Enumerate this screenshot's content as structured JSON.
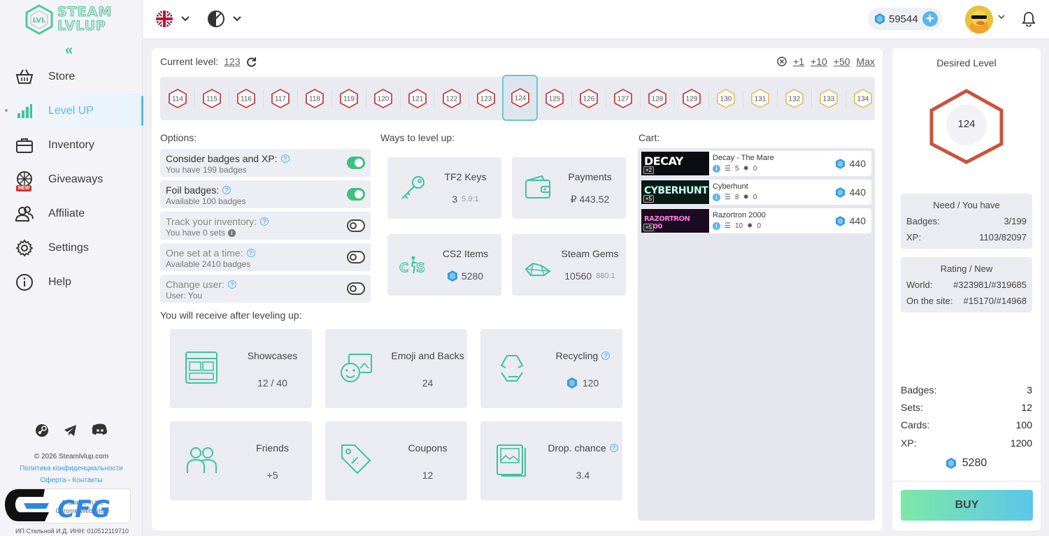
{
  "app": {
    "logo_line1": "STEAM",
    "logo_line2": "LVLUP",
    "accent": "#5db8ec",
    "green": "#3fc07e"
  },
  "sidebar": {
    "items": [
      {
        "label": "Store",
        "icon": "basket-icon"
      },
      {
        "label": "Level UP",
        "icon": "bar-chart-icon",
        "active": true
      },
      {
        "label": "Inventory",
        "icon": "briefcase-icon"
      },
      {
        "label": "Giveaways",
        "icon": "wheel-icon",
        "badge": "NEW"
      },
      {
        "label": "Affiliate",
        "icon": "users-icon"
      },
      {
        "label": "Settings",
        "icon": "gear-icon"
      },
      {
        "label": "Help",
        "icon": "info-icon"
      }
    ],
    "footer": {
      "copyright": "© 2026 Steamlvlup.com",
      "privacy": "Политика конфиденциальности",
      "offer": "Оферта",
      "sep": " - ",
      "contacts": "Контакты",
      "chrome": "Available in the Chrome Web Store",
      "inn": "ИП Стельной И.Д. ИНН: 010512119710"
    }
  },
  "topbar": {
    "balance": "59544"
  },
  "level": {
    "current_label": "Current level:",
    "current": "123",
    "add": [
      "+1",
      "+10",
      "+50",
      "Max"
    ],
    "strip": [
      "114",
      "115",
      "116",
      "117",
      "118",
      "119",
      "120",
      "121",
      "122",
      "123",
      "124",
      "125",
      "126",
      "127",
      "128",
      "129",
      "130",
      "131",
      "132",
      "133",
      "134"
    ],
    "selected": "124"
  },
  "options": {
    "title": "Options:",
    "items": [
      {
        "title": "Consider badges and XP:",
        "sub": "You have 199 badges",
        "on": true
      },
      {
        "title": "Foil badges:",
        "sub": "Available 100 badges",
        "on": true
      },
      {
        "title": "Track your inventory:",
        "sub": "You have 0 sets",
        "on": false
      },
      {
        "title": "One set at a time:",
        "sub": "Available 2410 badges",
        "on": false
      },
      {
        "title": "Change user:",
        "sub": "User: You",
        "on": false
      }
    ]
  },
  "ways": {
    "title": "Ways to level up:",
    "items": [
      {
        "name": "TF2 Keys",
        "value": "3",
        "rate": "5.9:1"
      },
      {
        "name": "Payments",
        "value": "₽ 443.52"
      },
      {
        "name": "CS2 Items",
        "value": "5280"
      },
      {
        "name": "Steam Gems",
        "value": "10560",
        "rate": "880:1"
      }
    ]
  },
  "receive": {
    "title": "You will receive after leveling up:",
    "items": [
      {
        "name": "Showcases",
        "value": "12 / 40"
      },
      {
        "name": "Emoji and Backs",
        "value": "24"
      },
      {
        "name": "Recycling",
        "value": "120"
      },
      {
        "name": "Friends",
        "value": "+5"
      },
      {
        "name": "Coupons",
        "value": "12"
      },
      {
        "name": "Drop. chance",
        "value": "3.4"
      }
    ]
  },
  "cart": {
    "title": "Cart:",
    "items": [
      {
        "name": "Decay - The Mare",
        "thumb": "DECAY",
        "mult": "×2",
        "sets": "5",
        "foil": "0",
        "price": "440"
      },
      {
        "name": "Cyberhunt",
        "thumb": "CYBERHUNT",
        "mult": "×5",
        "sets": "8",
        "foil": "0",
        "price": "440"
      },
      {
        "name": "Razortron 2000",
        "thumb": "RAZORTRON 2000",
        "mult": "×5",
        "sets": "10",
        "foil": "0",
        "price": "440"
      }
    ]
  },
  "right": {
    "title": "Desired Level",
    "level": "124",
    "need_title": "Need / You have",
    "badges_label": "Badges:",
    "badges_val": "3/199",
    "xp_label": "XP:",
    "xp_val": "1103/82097",
    "rating_title": "Rating / New",
    "world_label": "World:",
    "world_val": "#323981/#319685",
    "site_label": "On the site:",
    "site_val": "#15170/#14968",
    "sum_badges_label": "Badges:",
    "sum_badges": "3",
    "sum_sets_label": "Sets:",
    "sum_sets": "12",
    "sum_cards_label": "Cards:",
    "sum_cards": "100",
    "sum_xp_label": "XP:",
    "sum_xp": "1200",
    "total": "5280",
    "buy": "BUY"
  }
}
